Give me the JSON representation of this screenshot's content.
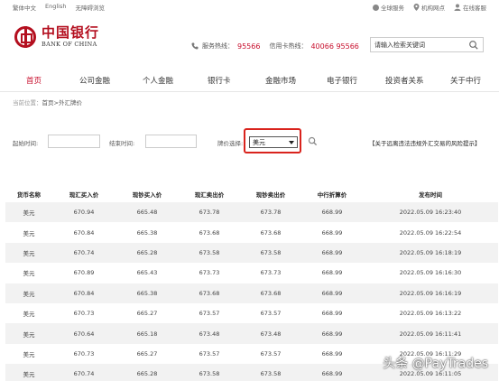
{
  "topbar": {
    "left": [
      "繁体中文",
      "English",
      "无障碍浏览"
    ],
    "global": "全球服务",
    "branches": "机构网点",
    "online": "在线客服"
  },
  "logo": {
    "cn": "中国银行",
    "en": "BANK OF CHINA"
  },
  "hotline": {
    "service_label": "服务热线：",
    "service_num": "95566",
    "card_label": "信用卡热线：",
    "card_num": "40066 95566"
  },
  "search": {
    "placeholder": "请输入检索关键词"
  },
  "nav": [
    "首页",
    "公司金融",
    "个人金融",
    "银行卡",
    "金融市场",
    "电子银行",
    "投资者关系",
    "关于中行"
  ],
  "breadcrumb": {
    "prefix": "当前位置：",
    "path": "首页>外汇牌价"
  },
  "filter": {
    "start_label": "起始时间:",
    "end_label": "结束时间:",
    "currency_label": "牌价选择:",
    "currency_value": "美元",
    "risk_link": "【关于远离违法违规外汇交易的风险提示】"
  },
  "table": {
    "headers": [
      "货币名称",
      "现汇买入价",
      "现钞买入价",
      "现汇卖出价",
      "现钞卖出价",
      "中行折算价",
      "发布时间"
    ],
    "rows": [
      [
        "美元",
        "670.94",
        "665.48",
        "673.78",
        "673.78",
        "668.99",
        "2022.05.09 16:23:40"
      ],
      [
        "美元",
        "670.84",
        "665.38",
        "673.68",
        "673.68",
        "668.99",
        "2022.05.09 16:22:54"
      ],
      [
        "美元",
        "670.74",
        "665.28",
        "673.58",
        "673.58",
        "668.99",
        "2022.05.09 16:18:19"
      ],
      [
        "美元",
        "670.89",
        "665.43",
        "673.73",
        "673.73",
        "668.99",
        "2022.05.09 16:16:30"
      ],
      [
        "美元",
        "670.84",
        "665.38",
        "673.68",
        "673.68",
        "668.99",
        "2022.05.09 16:16:19"
      ],
      [
        "美元",
        "670.73",
        "665.27",
        "673.57",
        "673.57",
        "668.99",
        "2022.05.09 16:13:22"
      ],
      [
        "美元",
        "670.64",
        "665.18",
        "673.48",
        "673.48",
        "668.99",
        "2022.05.09 16:11:41"
      ],
      [
        "美元",
        "670.73",
        "665.27",
        "673.57",
        "673.57",
        "668.99",
        "2022.05.09 16:11:29"
      ],
      [
        "美元",
        "670.74",
        "665.28",
        "673.58",
        "673.58",
        "668.99",
        "2022.05.09 16:11:05"
      ]
    ]
  },
  "watermark": "头条 @PayTrades",
  "colors": {
    "brand": "#b40f1f",
    "accent": "#c8102e",
    "highlight": "#d9231d"
  }
}
